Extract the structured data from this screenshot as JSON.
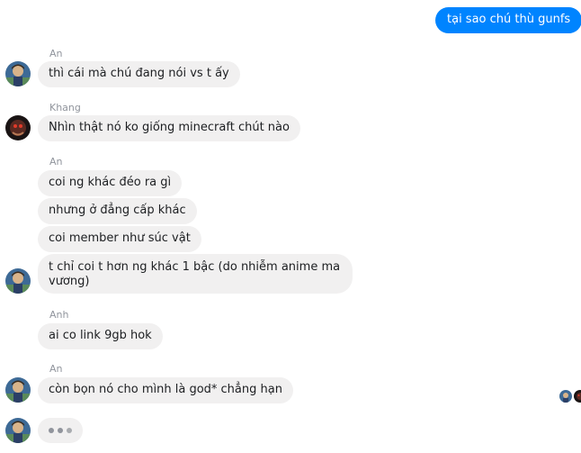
{
  "outgoing": [
    {
      "text": "tại sao chú thù gunfs"
    }
  ],
  "groups": [
    {
      "sender": "An",
      "avatar": "an-avatar",
      "messages": [
        "thì cái mà chú đang nói vs t ấy"
      ]
    },
    {
      "sender": "Khang",
      "avatar": "khang-avatar",
      "messages": [
        "Nhìn thật nó ko giống minecraft chút nào"
      ]
    },
    {
      "sender": "An",
      "avatar": "an-avatar",
      "messages": [
        "coi ng khác đéo ra gì",
        "nhưng ở đẳng cấp khác",
        "coi member như súc vật",
        "t chỉ coi t hơn ng khác 1 bậc (do  nhiễm anime ma vương)"
      ]
    },
    {
      "sender": "Anh",
      "avatar": "anh-avatar",
      "messages": [
        "ai co link 9gb hok"
      ]
    },
    {
      "sender": "An",
      "avatar": "an-avatar",
      "messages": [
        "còn bọn nó cho mình là god* chẳng hạn"
      ]
    }
  ],
  "typing": {
    "avatar": "an-avatar",
    "indicator": "typing-dots"
  },
  "colors": {
    "outgoing_bubble": "#0084ff",
    "incoming_bubble": "#f1f0f0",
    "sender_name": "#90949c",
    "typing_dot": "#90949c"
  }
}
